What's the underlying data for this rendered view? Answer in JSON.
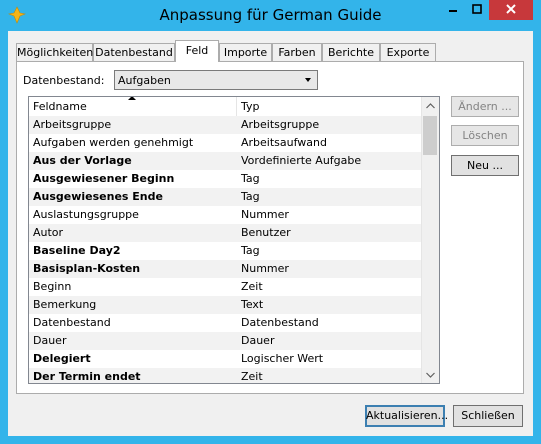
{
  "window": {
    "title": "Anpassung für German Guide",
    "accent": "#33b4ea",
    "close_color": "#c7383b"
  },
  "tabs": [
    {
      "label": "Möglichkeiten"
    },
    {
      "label": "Datenbestand"
    },
    {
      "label": "Feld",
      "active": true
    },
    {
      "label": "Importe"
    },
    {
      "label": "Farben"
    },
    {
      "label": "Berichte"
    },
    {
      "label": "Exporte"
    }
  ],
  "datasource": {
    "label": "Datenbestand:",
    "value": "Aufgaben"
  },
  "grid": {
    "columns": [
      "Feldname",
      "Typ"
    ],
    "sort_column": "Feldname",
    "rows": [
      {
        "name": "Arbeitsgruppe",
        "type": "Arbeitsgruppe",
        "bold": false
      },
      {
        "name": "Aufgaben werden genehmigt",
        "type": "Arbeitsaufwand",
        "bold": false
      },
      {
        "name": "Aus der Vorlage",
        "type": "Vordefinierte Aufgabe",
        "bold": true
      },
      {
        "name": "Ausgewiesener Beginn",
        "type": "Tag",
        "bold": true
      },
      {
        "name": "Ausgewiesenes Ende",
        "type": "Tag",
        "bold": true
      },
      {
        "name": "Auslastungsgruppe",
        "type": "Nummer",
        "bold": false
      },
      {
        "name": "Autor",
        "type": "Benutzer",
        "bold": false
      },
      {
        "name": "Baseline Day2",
        "type": "Tag",
        "bold": true
      },
      {
        "name": "Basisplan-Kosten",
        "type": "Nummer",
        "bold": true
      },
      {
        "name": "Beginn",
        "type": "Zeit",
        "bold": false
      },
      {
        "name": "Bemerkung",
        "type": "Text",
        "bold": false
      },
      {
        "name": "Datenbestand",
        "type": "Datenbestand",
        "bold": false
      },
      {
        "name": "Dauer",
        "type": "Dauer",
        "bold": false
      },
      {
        "name": "Delegiert",
        "type": "Logischer Wert",
        "bold": true
      },
      {
        "name": "Der Termin endet",
        "type": "Zeit",
        "bold": true
      }
    ]
  },
  "side_buttons": {
    "edit": "Ändern ...",
    "delete": "Löschen",
    "new": "Neu ..."
  },
  "bottom_buttons": {
    "refresh": "Aktualisieren...",
    "close": "Schließen"
  }
}
